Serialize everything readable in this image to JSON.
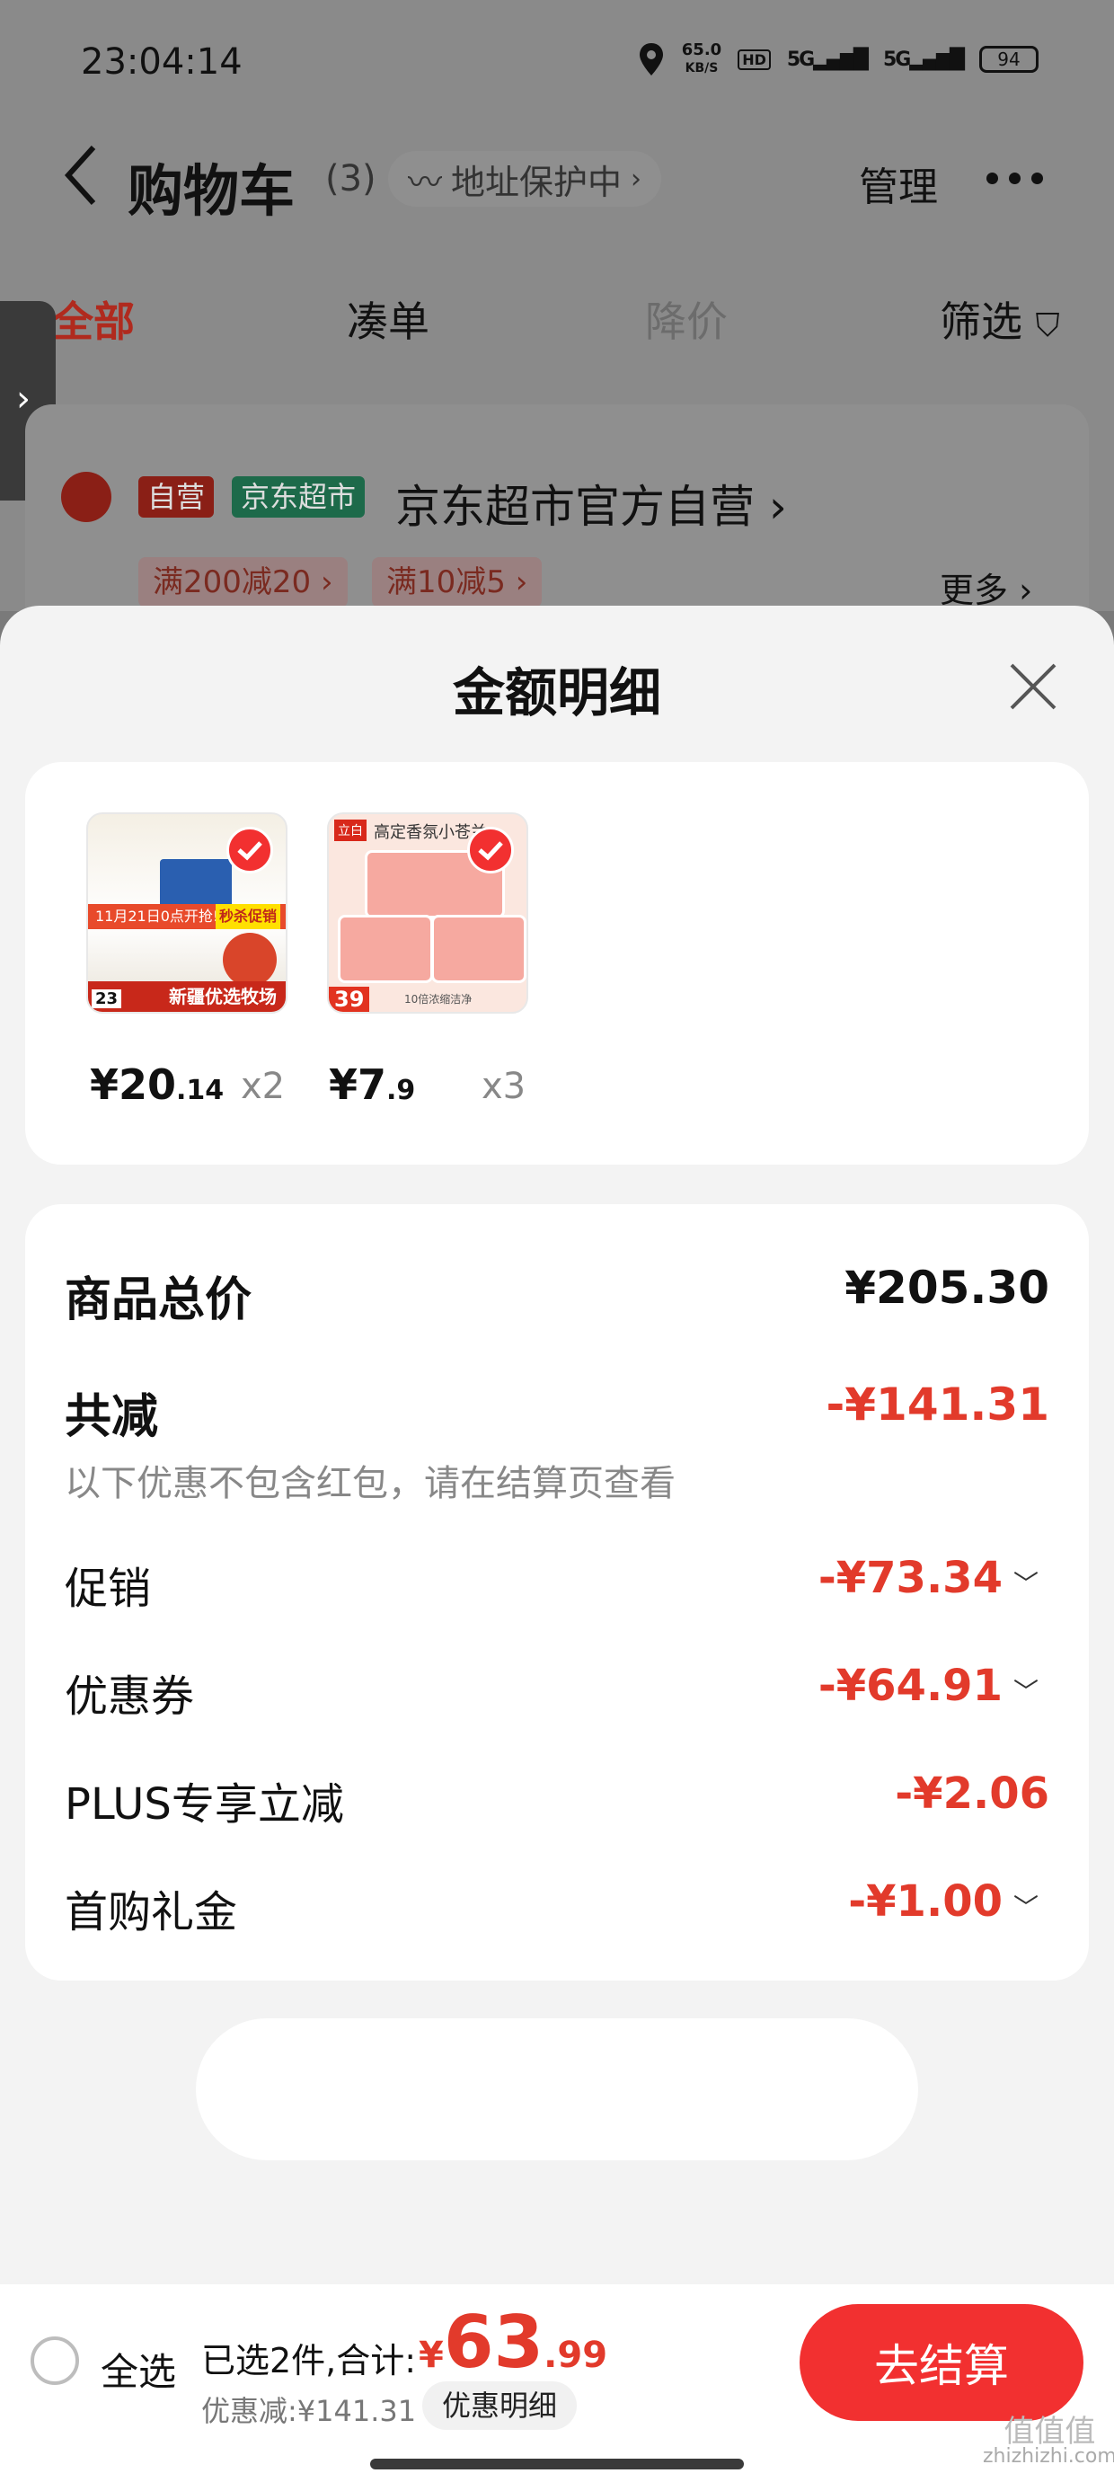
{
  "status_bar": {
    "time": "23:04:14",
    "net_speed_value": "65.0",
    "net_speed_unit": "KB/S",
    "hd": "HD",
    "net1": "5G",
    "net2": "5G",
    "battery": "94"
  },
  "nav": {
    "title": "购物车",
    "count": "(3)",
    "address_protect": "地址保护中",
    "manage": "管理"
  },
  "tabs": {
    "all": "全部",
    "bundle": "凑单",
    "price_drop": "降价",
    "filter": "筛选"
  },
  "store": {
    "tag_self": "自营",
    "tag_market": "京东超市",
    "name": "京东超市官方自营",
    "promo1": "满200减20",
    "promo2": "满10减5",
    "more": "更多"
  },
  "sheet": {
    "title": "金额明细"
  },
  "products": [
    {
      "price_int": "¥20",
      "price_dec": ".14",
      "qty": "x2"
    },
    {
      "price_int": "¥7",
      "price_dec": ".9",
      "qty": "x3"
    }
  ],
  "product_thumb_text": {
    "p1_banner": "11月21日0点开抢!",
    "p1_tag": "秒杀促销",
    "p1_footer": "新疆优选牧场",
    "p1_price": "23",
    "p2_title": "高定香氛小苍兰",
    "p2_price": "39",
    "p2_footer": "10倍浓缩洁净"
  },
  "details": {
    "total_label": "商品总价",
    "total_value": "¥205.30",
    "saved_label": "共减",
    "saved_value": "-¥141.31",
    "note": "以下优惠不包含红包，请在结算页查看",
    "items": [
      {
        "label": "促销",
        "value": "-¥73.34"
      },
      {
        "label": "优惠券",
        "value": "-¥64.91"
      },
      {
        "label": "PLUS专享立减",
        "value": "-¥2.06"
      },
      {
        "label": "首购礼金",
        "value": "-¥1.00"
      }
    ]
  },
  "checkout": {
    "select_all": "全选",
    "selected_text": "已选2件,合计:",
    "currency": "¥",
    "total_int": "63",
    "total_dec": ".99",
    "discount_text": "优惠减:¥141.31",
    "detail_button": "优惠明细",
    "pay_button": "去结算"
  },
  "watermark": {
    "line1": "值值值",
    "line2": "zhizhizhi.com"
  },
  "colors": {
    "accent_red": "#e23a2b",
    "pay_button": "#f23030",
    "sheet_bg": "#f3f3f3"
  }
}
